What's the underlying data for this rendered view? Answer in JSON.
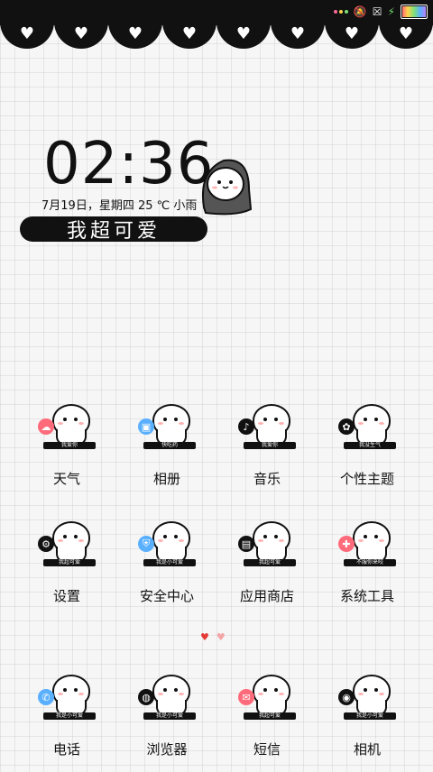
{
  "status_bar": {
    "icons": [
      "signal-dots-icon",
      "mute-icon",
      "no-sim-icon",
      "charging-bolt-icon",
      "battery-icon"
    ],
    "dot_colors": [
      "#ff6b9a",
      "#ffd54a",
      "#7ee07a",
      "#5ab0ff"
    ],
    "accent": "#111111"
  },
  "clock_widget": {
    "time": "02:36",
    "date": "7月19日，星期四  25 ℃  小雨",
    "label": "我超可爱"
  },
  "apps": [
    {
      "label": "天气",
      "tag": "我爱你",
      "badge_icon": "cloud-icon",
      "badge_color": "#ff6b7a"
    },
    {
      "label": "相册",
      "tag": "快吃药",
      "badge_icon": "photo-icon",
      "badge_color": "#5ab0ff"
    },
    {
      "label": "音乐",
      "tag": "我爱你",
      "badge_icon": "music-note-icon",
      "badge_color": "#111111"
    },
    {
      "label": "个性主题",
      "tag": "我没生气",
      "badge_icon": "palette-icon",
      "badge_color": "#111111"
    },
    {
      "label": "设置",
      "tag": "我超可爱",
      "badge_icon": "gear-icon",
      "badge_color": "#111111"
    },
    {
      "label": "安全中心",
      "tag": "我是小可爱",
      "badge_icon": "shield-icon",
      "badge_color": "#5ab0ff"
    },
    {
      "label": "应用商店",
      "tag": "我超可爱",
      "badge_icon": "shop-icon",
      "badge_color": "#111111"
    },
    {
      "label": "系统工具",
      "tag": "不服你来咬",
      "badge_icon": "tools-icon",
      "badge_color": "#ff6b7a"
    },
    {
      "label": "电话",
      "tag": "我是小可爱",
      "badge_icon": "phone-icon",
      "badge_color": "#5ab0ff"
    },
    {
      "label": "浏览器",
      "tag": "我是小可爱",
      "badge_icon": "globe-icon",
      "badge_color": "#111111"
    },
    {
      "label": "短信",
      "tag": "我超可爱",
      "badge_icon": "message-icon",
      "badge_color": "#ff6b7a"
    },
    {
      "label": "相机",
      "tag": "我是小可爱",
      "badge_icon": "camera-icon",
      "badge_color": "#111111"
    }
  ],
  "page_indicator": {
    "active_color": "#e53935",
    "inactive_color": "#f4a6a6"
  }
}
